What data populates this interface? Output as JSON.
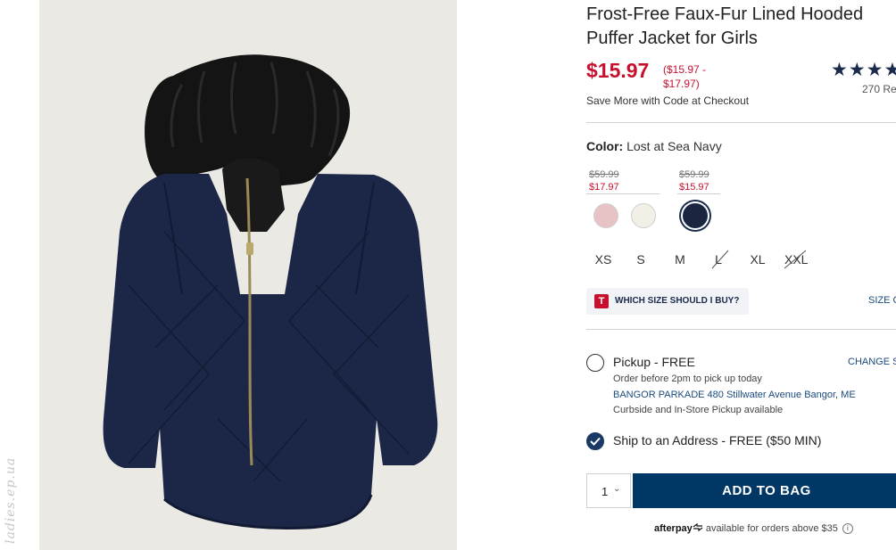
{
  "watermark": "ladies.ep.ua",
  "product": {
    "title": "Frost-Free Faux-Fur Lined Hooded Puffer Jacket for Girls",
    "price": "$15.97",
    "price_range": "($15.97 - $17.97)",
    "rating_stars": "★★★★★",
    "reviews_text": "270 Re",
    "save_more": "Save More with Code at Checkout"
  },
  "color": {
    "label": "Color:",
    "value": "Lost at Sea Navy",
    "groups": [
      {
        "old_price": "$59.99",
        "new_price": "$17.97"
      },
      {
        "old_price": "$59.99",
        "new_price": "$15.97"
      }
    ],
    "swatches": [
      {
        "name": "pink",
        "color": "#e8c3c5",
        "selected": false
      },
      {
        "name": "cream",
        "color": "#f2efe6",
        "selected": false
      },
      {
        "name": "navy",
        "color": "#1b2540",
        "selected": true
      }
    ]
  },
  "sizes": [
    {
      "label": "XS",
      "available": true
    },
    {
      "label": "S",
      "available": true
    },
    {
      "label": "M",
      "available": true
    },
    {
      "label": "L",
      "available": false
    },
    {
      "label": "XL",
      "available": true
    },
    {
      "label": "XXL",
      "available": false
    }
  ],
  "size_help": {
    "badge": "T",
    "label": "WHICH SIZE SHOULD I BUY?",
    "chart_link": "SIZE C"
  },
  "fulfillment": {
    "pickup": {
      "title": "Pickup - FREE",
      "order_by": "Order before 2pm to pick up today",
      "store": "BANGOR PARKADE 480 Stillwater Avenue  Bangor, ME",
      "curbside": "Curbside and In-Store Pickup available",
      "change_store": "CHANGE S"
    },
    "ship": {
      "title": "Ship to an Address - FREE ($50 MIN)"
    }
  },
  "quantity": {
    "value": "1",
    "chevron": "⌄"
  },
  "add_to_bag": "ADD TO BAG",
  "afterpay": {
    "brand": "afterpay",
    "text": "available for orders above $35",
    "info": "i"
  },
  "colors": {
    "accent_red": "#c8102e",
    "navy_button": "#003764",
    "link_blue": "#1a4a7c"
  }
}
